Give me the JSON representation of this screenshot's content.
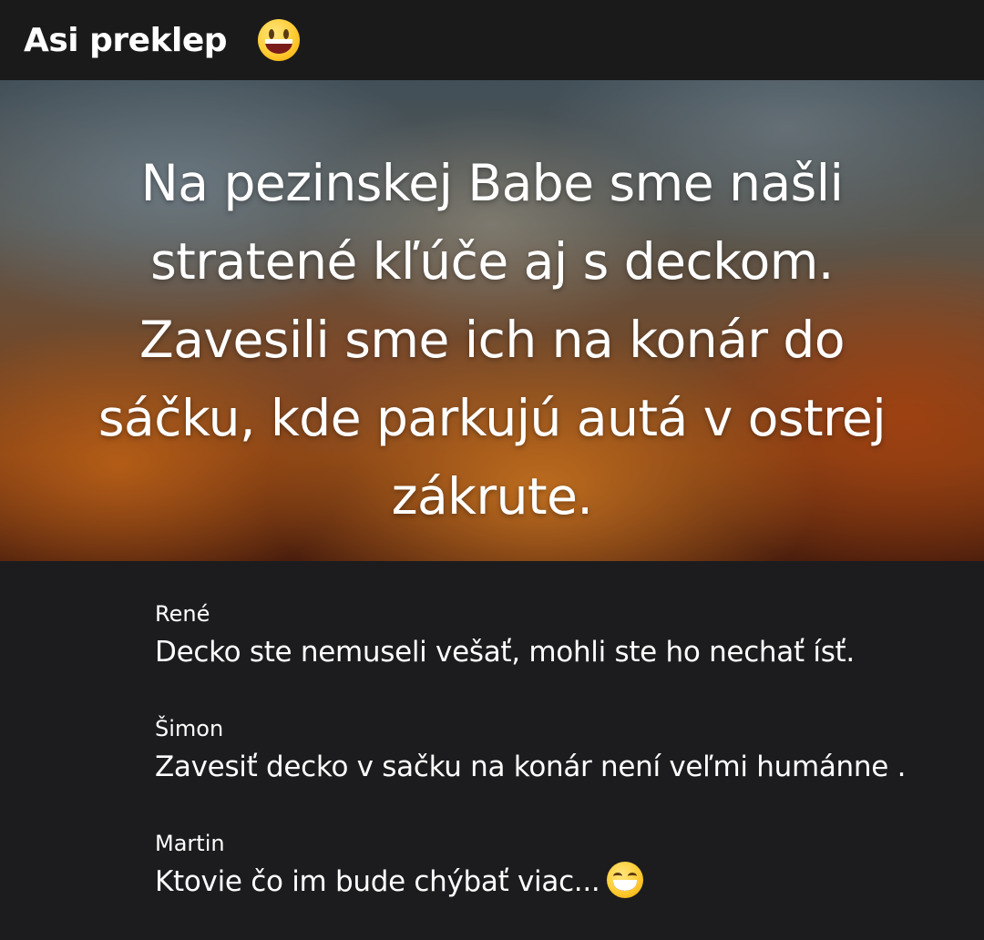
{
  "header": {
    "title": "Asi preklep",
    "emoji": "grinning-face-with-sweat-icon"
  },
  "hero": {
    "background": "cloudy-fiery-sky",
    "text": "Na pezinskej Babe sme našli stratené kľúče aj s deckom. Zavesili sme ich na konár do sáčku, kde parkujú autá v ostrej zákrute."
  },
  "comments": [
    {
      "author": "René",
      "text": "Decko ste nemuseli vešať, mohli ste ho nechať ísť."
    },
    {
      "author": "Šimon",
      "text": "Zavesiť decko v sačku na konár není veľmi humánne ."
    },
    {
      "author": "Martin",
      "text": "Ktovie čo im bude chýbať viac...",
      "emoji": "grinning-face-with-smiling-eyes-icon"
    }
  ],
  "colors": {
    "background": "#1c1c1e",
    "header_background": "#1a1a1a",
    "text": "#ffffff"
  }
}
